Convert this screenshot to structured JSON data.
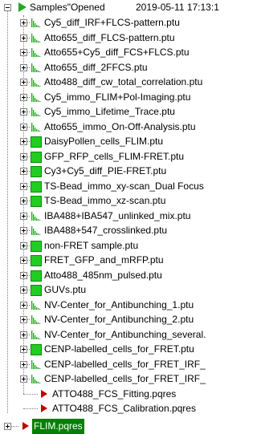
{
  "root": {
    "label": "Samples\"Opened",
    "date": "2019-05-11 17:13:1"
  },
  "items": [
    {
      "label": "Cy5_diff_IRF+FLCS-pattern.ptu",
      "icon": "decay-curve-icon"
    },
    {
      "label": "Atto655_diff_FLCS-pattern.ptu",
      "icon": "decay-curve-icon"
    },
    {
      "label": "Atto655+Cy5_diff_FCS+FLCS.ptu",
      "icon": "decay-curve-icon"
    },
    {
      "label": "Atto655_diff_2FFCS.ptu",
      "icon": "decay-curve-icon"
    },
    {
      "label": "Atto488_diff_cw_total_correlation.ptu",
      "icon": "decay-curve-icon"
    },
    {
      "label": "Cy5_immo_FLIM+Pol-Imaging.ptu",
      "icon": "decay-curve-icon"
    },
    {
      "label": "Cy5_immo_Lifetime_Trace.ptu",
      "icon": "decay-curve-icon"
    },
    {
      "label": "Atto655_immo_On-Off-Analysis.ptu",
      "icon": "decay-curve-icon"
    },
    {
      "label": "DaisyPollen_cells_FLIM.ptu",
      "icon": "image-icon"
    },
    {
      "label": "GFP_RFP_cells_FLIM-FRET.ptu",
      "icon": "image-icon"
    },
    {
      "label": "Cy3+Cy5_diff_PIE-FRET.ptu",
      "icon": "image-icon"
    },
    {
      "label": "TS-Bead_immo_xy-scan_Dual Focus",
      "icon": "image-icon"
    },
    {
      "label": "TS-Bead_immo_xz-scan.ptu",
      "icon": "image-icon"
    },
    {
      "label": "IBA488+IBA547_unlinked_mix.ptu",
      "icon": "decay-curve-icon"
    },
    {
      "label": "IBA488+547_crosslinked.ptu",
      "icon": "decay-curve-icon"
    },
    {
      "label": "non-FRET sample.ptu",
      "icon": "image-icon"
    },
    {
      "label": "FRET_GFP_and_mRFP.ptu",
      "icon": "image-icon"
    },
    {
      "label": "Atto488_485nm_pulsed.ptu",
      "icon": "image-icon"
    },
    {
      "label": "GUVs.ptu",
      "icon": "image-icon"
    },
    {
      "label": "NV-Center_for_Antibunching_1.ptu",
      "icon": "decay-curve-icon"
    },
    {
      "label": "NV-Center_for_Antibunching_2.ptu",
      "icon": "decay-curve-icon"
    },
    {
      "label": "NV-Center_for_Antibunching_several.",
      "icon": "decay-curve-icon"
    },
    {
      "label": "CENP-labelled_cells_for_FRET.ptu",
      "icon": "image-icon"
    },
    {
      "label": "CENP-labelled_cells_for_FRET_IRF_",
      "icon": "decay-curve-icon"
    },
    {
      "label": "CENP-labelled_cells_for_FRET_IRF_",
      "icon": "decay-curve-icon"
    }
  ],
  "pqres": [
    {
      "label": "ATTO488_FCS_Fitting.pqres",
      "icon": "play-arrow-icon"
    },
    {
      "label": "ATTO488_FCS_Calibration.pqres",
      "icon": "play-arrow-icon"
    }
  ],
  "flim": {
    "label": "FLIM.pqres",
    "icon": "play-arrow-icon"
  },
  "colors": {
    "selection": "#008000",
    "green": "#22cc22",
    "arrow": "#c00000"
  }
}
